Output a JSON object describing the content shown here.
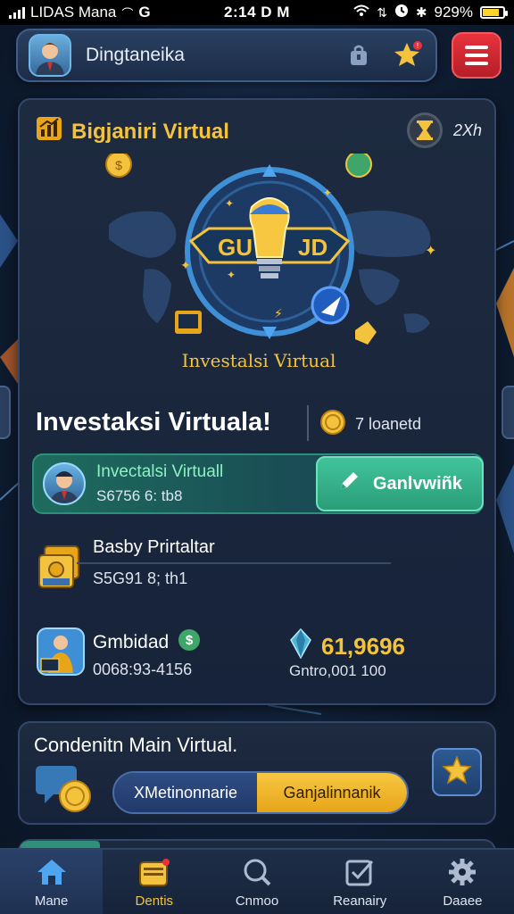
{
  "status": {
    "carrier": "LIDAS Mana",
    "time": "2:14 D M",
    "battery": "929%"
  },
  "header": {
    "title": "Dingtaneika"
  },
  "card": {
    "title": "Bigjaniri Virtual",
    "timer_label": "2Xh",
    "hero_caption": "Investalsi Virtual",
    "hero_sign_left": "GU",
    "hero_sign_right": "JD",
    "headline": "Investaksi Virtuala!",
    "loaned": "7 loanetd",
    "invest": {
      "name": "Invectalsi Virtuall",
      "value": "S6756 6: tb8",
      "cta": "Ganlvwiñk"
    },
    "balance": {
      "label": "Basby Prirtaltar",
      "value": "S5G91 8; th1"
    },
    "contribution": {
      "label": "Gmbidad",
      "value": "0068:93-4156",
      "gem_value": "61,9696",
      "gem_sub": "Gntro,001 100"
    }
  },
  "secondary": {
    "title": "Condenitn Main Virtual.",
    "toggle_left": "XMetinonnarie",
    "toggle_right": "Ganjalinnanik"
  },
  "nav": [
    {
      "label": "Mane",
      "icon": "home-icon"
    },
    {
      "label": "Dentis",
      "icon": "wallet-icon"
    },
    {
      "label": "Cnmoo",
      "icon": "search-icon"
    },
    {
      "label": "Reanairy",
      "icon": "checklist-icon"
    },
    {
      "label": "Daaee",
      "icon": "gear-icon"
    }
  ],
  "colors": {
    "accent_gold": "#f4c33d",
    "accent_green": "#41c49b",
    "menu_red": "#e8333d",
    "bg_navy": "#0f1d33"
  }
}
